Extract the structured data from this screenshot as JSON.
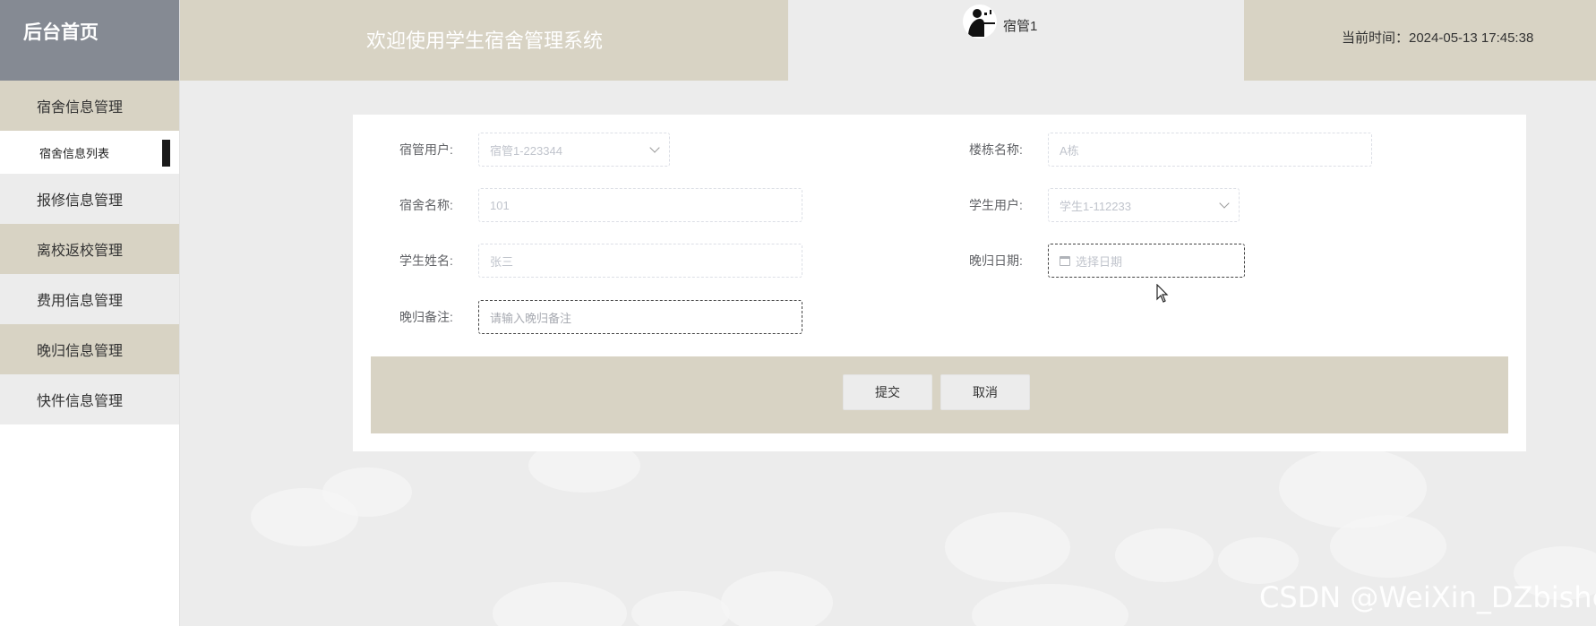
{
  "sidebar": {
    "home_label": "后台首页",
    "items": [
      {
        "label": "宿舍信息管理"
      },
      {
        "label": "宿舍信息列表"
      },
      {
        "label": "报修信息管理"
      },
      {
        "label": "离校返校管理"
      },
      {
        "label": "费用信息管理"
      },
      {
        "label": "晚归信息管理"
      },
      {
        "label": "快件信息管理"
      }
    ]
  },
  "header": {
    "welcome": "欢迎使用学生宿舍管理系统",
    "username": "宿管1",
    "time_label": "当前时间：2024-05-13 17:45:38"
  },
  "form": {
    "dorm_manager_label": "宿管用户:",
    "dorm_manager_value": "宿管1-223344",
    "building_label": "楼栋名称:",
    "building_value": "A栋",
    "dorm_name_label": "宿舍名称:",
    "dorm_name_value": "101",
    "student_user_label": "学生用户:",
    "student_user_value": "学生1-112233",
    "student_name_label": "学生姓名:",
    "student_name_value": "张三",
    "late_date_label": "晚归日期:",
    "late_date_placeholder": "选择日期",
    "late_note_label": "晚归备注:",
    "late_note_placeholder": "请输入晚归备注"
  },
  "buttons": {
    "submit": "提交",
    "cancel": "取消"
  },
  "watermark": "CSDN @WeiXin_DZbishe",
  "colors": {
    "beige": "#d8d3c4",
    "sidebar_home": "#858a93",
    "background": "#ececec"
  }
}
